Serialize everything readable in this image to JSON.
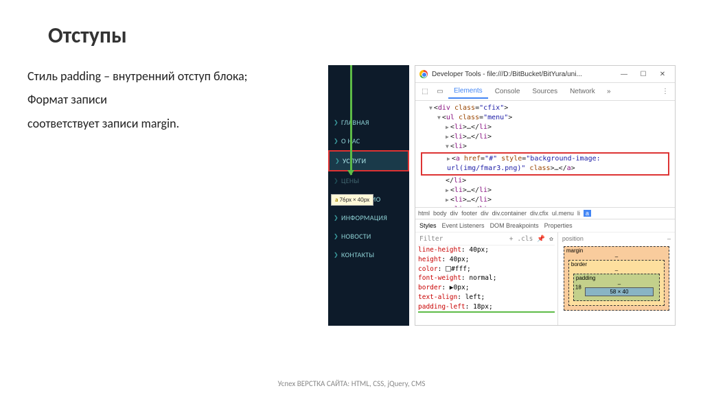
{
  "title": "Отступы",
  "body": {
    "line1": "Стиль padding – внутренний отступ блока;",
    "line2": "Формат записи",
    "line3": "соответствует записи margin."
  },
  "nav": {
    "items": [
      "ГЛАВНАЯ",
      "О НАС",
      "УСЛУГИ",
      "ЦЕНЫ",
      "ПОРТФОЛИО",
      "ИНФОРМАЦИЯ",
      "НОВОСТИ",
      "КОНТАКТЫ"
    ],
    "selected_index": 2,
    "tooltip_tag": "a",
    "tooltip_size": "76px × 40px"
  },
  "devtools": {
    "window_title": "Developer Tools - file:///D:/BitBucket/BitYura/uni...",
    "tabs": [
      "Elements",
      "Console",
      "Sources",
      "Network"
    ],
    "active_tab": 0,
    "dom": {
      "div_class": "cfix",
      "ul_class": "menu",
      "li_generic": "<li>…</li>",
      "highlighted": "<a href=\"#\" style=\"background-image: url(img/fmar3.png)\" class>…</a>"
    },
    "crumbs": [
      "html",
      "body",
      "div",
      "footer",
      "div",
      "div.container",
      "div.cfix",
      "ul.menu",
      "li",
      "a"
    ],
    "sub_tabs": [
      "Styles",
      "Event Listeners",
      "DOM Breakpoints",
      "Properties"
    ],
    "filter_placeholder": "Filter",
    "cls_label": ".cls",
    "css": [
      {
        "prop": "line-height",
        "val": "40px"
      },
      {
        "prop": "height",
        "val": "40px"
      },
      {
        "prop": "color",
        "val": "#fff",
        "swatch": true
      },
      {
        "prop": "font-weight",
        "val": "normal"
      },
      {
        "prop": "border",
        "val": "0px",
        "tri": true
      },
      {
        "prop": "text-align",
        "val": "left"
      },
      {
        "prop": "padding-left",
        "val": "18px",
        "ul": true
      }
    ],
    "position_label": "position",
    "box": {
      "margin": "margin",
      "border": "border",
      "padding": "padding",
      "pad_left": "18",
      "inner": "58 × 40",
      "dash": "–"
    }
  },
  "footer": "Успех ВЕРСТКА САЙТА: HTML, CSS, jQuery, CMS"
}
